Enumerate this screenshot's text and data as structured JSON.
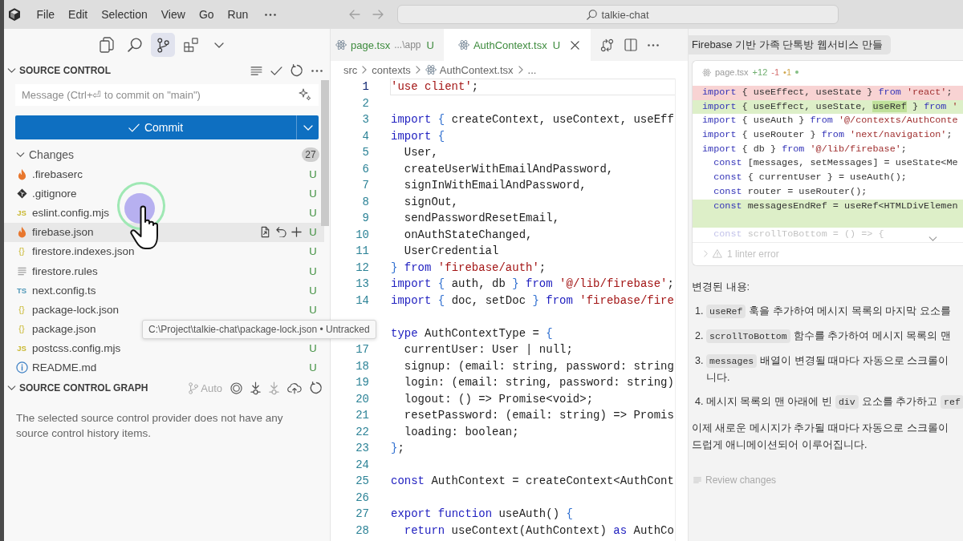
{
  "title_bar": {
    "menus": [
      {
        "label": "File"
      },
      {
        "label": "Edit"
      },
      {
        "label": "Selection"
      },
      {
        "label": "View"
      },
      {
        "label": "Go"
      },
      {
        "label": "Run"
      }
    ],
    "command_center": {
      "label": "talkie-chat"
    }
  },
  "activity_bar": {
    "items": [
      {
        "selected": false
      },
      {
        "selected": false
      },
      {
        "selected": true
      },
      {
        "selected": false
      }
    ]
  },
  "source_control": {
    "title": "SOURCE CONTROL",
    "expanded": true,
    "message_field": {
      "placeholder": "Message (Ctrl+⏎ to commit on \"main\")"
    },
    "commit_button": {
      "label": "Commit"
    },
    "changes": {
      "label": "Changes",
      "count": "27",
      "expanded": true,
      "files": [
        {
          "name": ".firebaserc",
          "kind": "firebase",
          "status": "U",
          "hovered": false
        },
        {
          "name": ".gitignore",
          "kind": "git",
          "status": "U",
          "hovered": false
        },
        {
          "name": "eslint.config.mjs",
          "kind": "js",
          "icon_text": "JS",
          "status": "U",
          "hovered": false
        },
        {
          "name": "firebase.json",
          "kind": "firebase",
          "status": "U",
          "hovered": true
        },
        {
          "name": "firestore.indexes.json",
          "kind": "json",
          "icon_text": "{}",
          "status": "U",
          "hovered": false
        },
        {
          "name": "firestore.rules",
          "kind": "text",
          "status": "U",
          "hovered": false
        },
        {
          "name": "next.config.ts",
          "kind": "ts",
          "icon_text": "TS",
          "status": "U",
          "hovered": false
        },
        {
          "name": "package-lock.json",
          "kind": "json",
          "icon_text": "{}",
          "status": "U",
          "hovered": false
        },
        {
          "name": "package.json",
          "kind": "json",
          "icon_text": "{}",
          "hovered": false
        },
        {
          "name": "postcss.config.mjs",
          "kind": "js",
          "icon_text": "JS",
          "status": "U",
          "hovered": false
        },
        {
          "name": "README.md",
          "kind": "info",
          "status": "U",
          "hovered": false
        }
      ]
    }
  },
  "source_control_graph": {
    "title": "SOURCE CONTROL GRAPH",
    "expanded": true,
    "auto_label": "Auto",
    "message": "The selected source control provider does not have any source control history items."
  },
  "tooltip": {
    "text": "C:\\Project\\talkie-chat\\package-lock.json • Untracked"
  },
  "editor": {
    "tabs": [
      {
        "label": "page.tsx",
        "description": "...\\app",
        "status": "U",
        "selected": false
      },
      {
        "label": "AuthContext.tsx",
        "status": "U",
        "selected": true
      }
    ],
    "breadcrumb": [
      {
        "label": "src",
        "kind": "folder"
      },
      {
        "label": "contexts",
        "kind": "folder"
      },
      {
        "label": "AuthContext.tsx",
        "kind": "file"
      },
      {
        "label": "...",
        "kind": "more"
      }
    ],
    "lines": [
      {
        "number": "1",
        "current": true,
        "tokens": [
          {
            "kind": "string",
            "text": "'use client'"
          },
          {
            "kind": "plain",
            "text": ";"
          }
        ]
      },
      {
        "number": "2",
        "current": false
      },
      {
        "number": "3",
        "current": false,
        "tokens": [
          {
            "kind": "keyword",
            "text": "import"
          },
          {
            "kind": "bracket",
            "text": " {"
          },
          {
            "kind": "plain",
            "text": " createContext, useContext, useEff"
          }
        ]
      },
      {
        "number": "4",
        "current": false,
        "tokens": [
          {
            "kind": "keyword",
            "text": "import"
          },
          {
            "kind": "bracket",
            "text": " {"
          }
        ]
      },
      {
        "number": "5",
        "current": false,
        "tokens": [
          {
            "kind": "plain",
            "text": "  User,"
          }
        ]
      },
      {
        "number": "6",
        "current": false,
        "tokens": [
          {
            "kind": "plain",
            "text": "  createUserWithEmailAndPassword,"
          }
        ]
      },
      {
        "number": "7",
        "current": false,
        "tokens": [
          {
            "kind": "plain",
            "text": "  signInWithEmailAndPassword,"
          }
        ]
      },
      {
        "number": "8",
        "current": false,
        "tokens": [
          {
            "kind": "plain",
            "text": "  signOut,"
          }
        ]
      },
      {
        "number": "9",
        "current": false,
        "tokens": [
          {
            "kind": "plain",
            "text": "  sendPasswordResetEmail,"
          }
        ]
      },
      {
        "number": "10",
        "current": false,
        "tokens": [
          {
            "kind": "plain",
            "text": "  onAuthStateChanged,"
          }
        ]
      },
      {
        "number": "11",
        "current": false,
        "tokens": [
          {
            "kind": "plain",
            "text": "  UserCredential"
          }
        ]
      },
      {
        "number": "12",
        "current": false,
        "tokens": [
          {
            "kind": "bracket",
            "text": "}"
          },
          {
            "kind": "keyword",
            "text": " from"
          },
          {
            "kind": "string",
            "text": " 'firebase/auth'"
          },
          {
            "kind": "plain",
            "text": ";"
          }
        ]
      },
      {
        "number": "13",
        "current": false,
        "tokens": [
          {
            "kind": "keyword",
            "text": "import"
          },
          {
            "kind": "bracket",
            "text": " {"
          },
          {
            "kind": "plain",
            "text": " auth, db "
          },
          {
            "kind": "bracket",
            "text": "}"
          },
          {
            "kind": "keyword",
            "text": " from"
          },
          {
            "kind": "string",
            "text": " '@/lib/firebase'"
          },
          {
            "kind": "plain",
            "text": ";"
          }
        ]
      },
      {
        "number": "14",
        "current": false,
        "tokens": [
          {
            "kind": "keyword",
            "text": "import"
          },
          {
            "kind": "bracket",
            "text": " {"
          },
          {
            "kind": "plain",
            "text": " doc, setDoc "
          },
          {
            "kind": "bracket",
            "text": "}"
          },
          {
            "kind": "keyword",
            "text": " from"
          },
          {
            "kind": "string",
            "text": " 'firebase/fire"
          }
        ]
      },
      {
        "current": false
      },
      {
        "current": false,
        "tokens": [
          {
            "kind": "keyword",
            "text": "type"
          },
          {
            "kind": "plain",
            "text": " AuthContextType ="
          },
          {
            "kind": "bracket",
            "text": " {"
          }
        ]
      },
      {
        "number": "17",
        "current": false,
        "tokens": [
          {
            "kind": "plain",
            "text": "  currentUser: User | null;"
          }
        ]
      },
      {
        "number": "18",
        "current": false,
        "tokens": [
          {
            "kind": "plain",
            "text": "  signup: (email: string, password: string"
          }
        ]
      },
      {
        "number": "19",
        "current": false,
        "tokens": [
          {
            "kind": "plain",
            "text": "  login: (email: string, password: string)"
          }
        ]
      },
      {
        "number": "20",
        "current": false,
        "tokens": [
          {
            "kind": "plain",
            "text": "  logout: () => Promise<void>;"
          }
        ]
      },
      {
        "number": "21",
        "current": false,
        "tokens": [
          {
            "kind": "plain",
            "text": "  resetPassword: (email: string) => Promis"
          }
        ]
      },
      {
        "number": "22",
        "current": false,
        "tokens": [
          {
            "kind": "plain",
            "text": "  loading: boolean;"
          }
        ]
      },
      {
        "number": "23",
        "current": false,
        "tokens": [
          {
            "kind": "bracket",
            "text": "}"
          },
          {
            "kind": "plain",
            "text": ";"
          }
        ]
      },
      {
        "number": "24",
        "current": false
      },
      {
        "number": "25",
        "current": false,
        "tokens": [
          {
            "kind": "keyword",
            "text": "const"
          },
          {
            "kind": "plain",
            "text": " AuthContext = createContext<AuthCont"
          }
        ]
      },
      {
        "number": "26",
        "current": false
      },
      {
        "number": "27",
        "current": false,
        "tokens": [
          {
            "kind": "keyword",
            "text": "export"
          },
          {
            "kind": "keyword",
            "text": " function"
          },
          {
            "kind": "plain",
            "text": " useAuth()"
          },
          {
            "kind": "bracket",
            "text": " {"
          }
        ]
      },
      {
        "number": "28",
        "current": false,
        "tokens": [
          {
            "kind": "keyword",
            "text": "  return"
          },
          {
            "kind": "plain",
            "text": " useContext(AuthContext) "
          },
          {
            "kind": "keyword",
            "text": "as"
          },
          {
            "kind": "plain",
            "text": " AuthCo"
          }
        ]
      }
    ]
  },
  "chat": {
    "title": "Firebase 기반 가족 단톡방 웹서비스 만들",
    "diff_card": {
      "file": "page.tsx",
      "stats": [
        {
          "kind": "added",
          "text": "+12"
        },
        {
          "kind": "removed",
          "text": "-1"
        },
        {
          "kind": "warning",
          "text": "•1"
        }
      ],
      "lines": [
        {
          "kind": "removed",
          "tokens": [
            {
              "kind": "keyword",
              "text": "import"
            },
            {
              "kind": "plain",
              "text": " { useEffect, useState } "
            },
            {
              "kind": "keyword",
              "text": "from"
            },
            {
              "kind": "string",
              "text": " 'react'"
            },
            {
              "kind": "plain",
              "text": ";"
            }
          ]
        },
        {
          "kind": "added",
          "tokens": [
            {
              "kind": "keyword",
              "text": "import"
            },
            {
              "kind": "plain",
              "text": " { useEffect, useState, "
            },
            {
              "kind": "inserted",
              "text": "useRef"
            },
            {
              "kind": "plain",
              "text": " } "
            },
            {
              "kind": "keyword",
              "text": "from"
            },
            {
              "kind": "string",
              "text": " '"
            }
          ]
        },
        {
          "kind": "context",
          "tokens": [
            {
              "kind": "keyword",
              "text": "import"
            },
            {
              "kind": "plain",
              "text": " { useAuth } "
            },
            {
              "kind": "keyword",
              "text": "from"
            },
            {
              "kind": "string",
              "text": " '@/contexts/AuthConte"
            }
          ]
        },
        {
          "kind": "context",
          "tokens": [
            {
              "kind": "keyword",
              "text": "import"
            },
            {
              "kind": "plain",
              "text": " { useRouter } "
            },
            {
              "kind": "keyword",
              "text": "from"
            },
            {
              "kind": "string",
              "text": " 'next/navigation'"
            },
            {
              "kind": "plain",
              "text": ";"
            }
          ]
        },
        {
          "kind": "context",
          "tokens": [
            {
              "kind": "keyword",
              "text": "import"
            },
            {
              "kind": "plain",
              "text": " { db } "
            },
            {
              "kind": "keyword",
              "text": "from"
            },
            {
              "kind": "string",
              "text": " '@/lib/firebase'"
            },
            {
              "kind": "plain",
              "text": ";"
            }
          ]
        },
        {
          "kind": "context",
          "tokens": [
            {
              "kind": "keyword",
              "text": "  const"
            },
            {
              "kind": "plain",
              "text": " [messages, setMessages] = useState<Me"
            }
          ]
        },
        {
          "kind": "context",
          "tokens": [
            {
              "kind": "keyword",
              "text": "  const"
            },
            {
              "kind": "plain",
              "text": " { currentUser } = useAuth();"
            }
          ]
        },
        {
          "kind": "context",
          "tokens": [
            {
              "kind": "keyword",
              "text": "  const"
            },
            {
              "kind": "plain",
              "text": " router = useRouter();"
            }
          ]
        },
        {
          "kind": "added",
          "tokens": [
            {
              "kind": "keyword",
              "text": "  const"
            },
            {
              "kind": "plain",
              "text": " messagesEndRef = useRef<HTMLDivElemen"
            }
          ]
        },
        {
          "kind": "added"
        },
        {
          "kind": "faded",
          "tokens": [
            {
              "kind": "keyword",
              "text": "  const"
            },
            {
              "kind": "plain",
              "text": " scrollToBottom = () => {"
            }
          ]
        }
      ],
      "linter": {
        "label": "1 linter error",
        "expanded": false
      }
    },
    "heading": "변경된 내용:",
    "steps": [
      {
        "number": "1.",
        "lines": [
          [
            {
              "kind": "code",
              "text": "useRef"
            },
            {
              "kind": "text",
              "text": "훅을 추가하여 메시지 목록의 마지막 요소를"
            }
          ]
        ]
      },
      {
        "number": "2.",
        "lines": [
          [
            {
              "kind": "code",
              "text": "scrollToBottom"
            },
            {
              "kind": "text",
              "text": "함수를 추가하여 메시지 목록의 맨"
            }
          ]
        ]
      },
      {
        "number": "3.",
        "lines": [
          [
            {
              "kind": "code",
              "text": "messages"
            },
            {
              "kind": "text",
              "text": "배열이 변경될 때마다 자동으로 스크롤이"
            }
          ],
          [
            {
              "kind": "text",
              "text": "니다."
            }
          ]
        ]
      },
      {
        "number": "4.",
        "lines": [
          [
            {
              "kind": "text",
              "text": "메시지 목록의 맨 아래에 빈"
            },
            {
              "kind": "code",
              "text": "div"
            },
            {
              "kind": "text",
              "text": "요소를 추가하고"
            },
            {
              "kind": "code",
              "text": "ref"
            }
          ]
        ]
      }
    ],
    "conclusion": [
      "이제 새로운 메시지가 추가될 때마다 자동으로 스크롤이",
      "드럽게 애니메이션되어 이루어집니다."
    ],
    "review": {
      "label": "Review changes"
    }
  }
}
